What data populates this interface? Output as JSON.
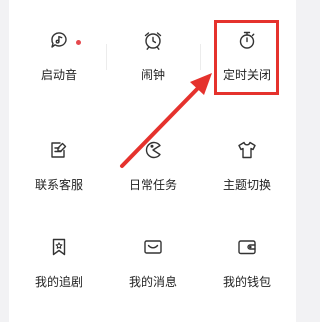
{
  "menu": {
    "items": [
      {
        "id": "wake-sound",
        "label": "启动音",
        "icon": "music-bubble-icon",
        "badge": true
      },
      {
        "id": "alarm",
        "label": "闹钟",
        "icon": "alarm-clock-icon",
        "badge": false
      },
      {
        "id": "timer-off",
        "label": "定时关闭",
        "icon": "stopwatch-icon",
        "badge": false
      },
      {
        "id": "customer-service",
        "label": "联系客服",
        "icon": "edit-note-icon",
        "badge": false
      },
      {
        "id": "daily-tasks",
        "label": "日常任务",
        "icon": "pacman-icon",
        "badge": false
      },
      {
        "id": "theme-switch",
        "label": "主题切换",
        "icon": "tshirt-icon",
        "badge": false
      },
      {
        "id": "my-shows",
        "label": "我的追剧",
        "icon": "bookmark-icon",
        "badge": false
      },
      {
        "id": "my-messages",
        "label": "我的消息",
        "icon": "envelope-icon",
        "badge": false
      },
      {
        "id": "my-wallet",
        "label": "我的钱包",
        "icon": "wallet-icon",
        "badge": false
      }
    ]
  },
  "annotation": {
    "highlight_color": "#e5322d",
    "highlighted_item": "定时关闭"
  },
  "colors": {
    "badge": "#e5484d",
    "icon_stroke": "#333333",
    "text": "#222222"
  }
}
